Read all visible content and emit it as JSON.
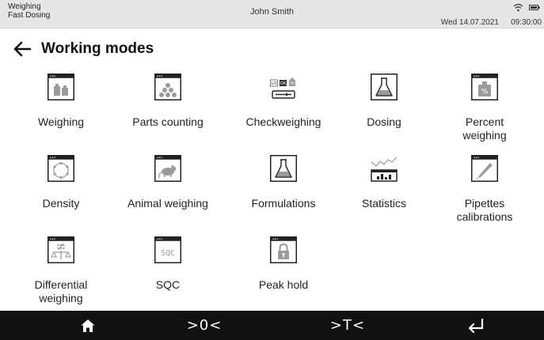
{
  "status": {
    "mode": "Weighing",
    "submode": "Fast Dosing",
    "user": "John Smith",
    "date": "Wed 14.07.2021",
    "time": "09:30:00",
    "icons": [
      "wifi-icon",
      "battery-icon"
    ]
  },
  "header": {
    "title": "Working modes",
    "back_icon": "arrow-left-icon"
  },
  "modes": [
    {
      "label": "Weighing",
      "icon": "weighing-icon"
    },
    {
      "label": "Parts counting",
      "icon": "parts-counting-icon"
    },
    {
      "label": "Checkweighing",
      "icon": "checkweighing-icon"
    },
    {
      "label": "Dosing",
      "icon": "dosing-icon"
    },
    {
      "label": "Percent\nweighing",
      "icon": "percent-weighing-icon"
    },
    {
      "label": "Density",
      "icon": "density-icon"
    },
    {
      "label": "Animal weighing",
      "icon": "animal-weighing-icon"
    },
    {
      "label": "Formulations",
      "icon": "formulations-icon"
    },
    {
      "label": "Statistics",
      "icon": "statistics-icon"
    },
    {
      "label": "Pipettes\ncalibrations",
      "icon": "pipettes-calibrations-icon"
    },
    {
      "label": "Differential\nweighing",
      "icon": "differential-weighing-icon"
    },
    {
      "label": "SQC",
      "icon": "sqc-icon"
    },
    {
      "label": "Peak hold",
      "icon": "peak-hold-icon"
    }
  ],
  "checkweigh_labels": [
    "LO",
    "OK",
    "HI"
  ],
  "sqc_icon_text": "SQC",
  "percent_icon_text": "%",
  "bottom": {
    "zero_label": ">0<",
    "tare_label": ">T<",
    "icons": [
      "home-icon",
      "zero-icon",
      "tare-icon",
      "enter-icon"
    ]
  },
  "colors": {
    "statusbar": "#e6e6e6",
    "bottombar": "#111111",
    "icon_dark": "#222222",
    "icon_fill": "#9a9a9a"
  }
}
